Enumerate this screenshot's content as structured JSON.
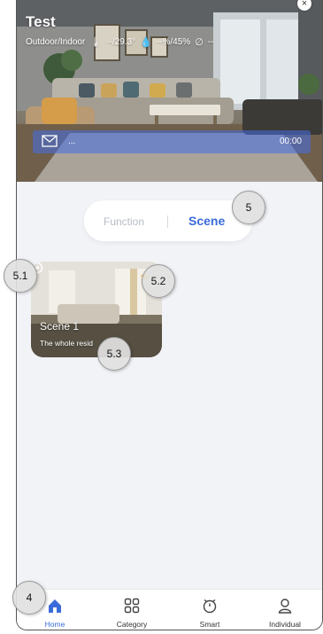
{
  "header": {
    "home_name": "Test",
    "weather": {
      "label": "Outdoor/Indoor",
      "temperature": "--/29.3°",
      "humidity": "--%/45%",
      "air": "--"
    },
    "message": {
      "text": "...",
      "time": "00:00"
    }
  },
  "tabs": {
    "function": "Function",
    "scene": "Scene",
    "active": "Scene"
  },
  "scenes": [
    {
      "name": "Scene 1",
      "description": "The whole resid",
      "favorite": true
    }
  ],
  "callouts": {
    "nav": "4",
    "tabs": "5",
    "settings": "5.1",
    "favorite": "5.2",
    "card": "5.3"
  },
  "nav": {
    "home": "Home",
    "category": "Category",
    "smart": "Smart",
    "individual": "Individual",
    "active": "Home"
  },
  "colors": {
    "accent": "#3a6bd9",
    "star": "#f4b21f",
    "background": "#f2f3f7"
  }
}
